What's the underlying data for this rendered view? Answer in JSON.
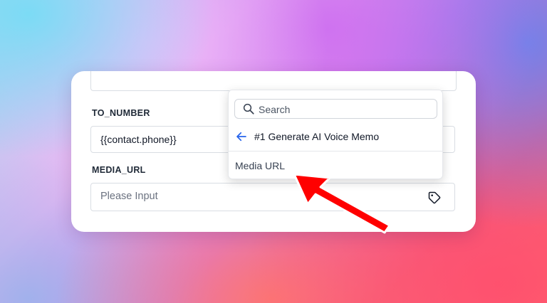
{
  "fields": [
    {
      "label": "TO_NUMBER",
      "value": "{{contact.phone}}"
    },
    {
      "label": "MEDIA_URL",
      "placeholder": "Please Input",
      "icon": "tag-icon"
    }
  ],
  "dropdown": {
    "search_placeholder": "Search",
    "back_label": "#1 Generate AI Voice Memo",
    "options": [
      "Media URL"
    ]
  },
  "colors": {
    "accent": "#2563eb",
    "annotation_arrow": "#ff0000"
  }
}
